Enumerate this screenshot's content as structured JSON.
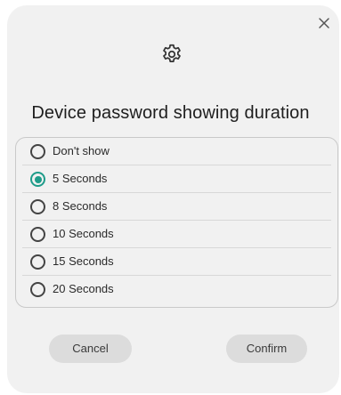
{
  "dialog": {
    "close_icon": "close-icon",
    "header_icon": "gear-icon",
    "title": "Device password showing duration",
    "accent_color": "#1f9c8a",
    "options": [
      {
        "label": "Don't show",
        "selected": false
      },
      {
        "label": "5 Seconds",
        "selected": true
      },
      {
        "label": "8 Seconds",
        "selected": false
      },
      {
        "label": "10 Seconds",
        "selected": false
      },
      {
        "label": "15 Seconds",
        "selected": false
      },
      {
        "label": "20 Seconds",
        "selected": false
      }
    ],
    "cancel_label": "Cancel",
    "confirm_label": "Confirm"
  }
}
